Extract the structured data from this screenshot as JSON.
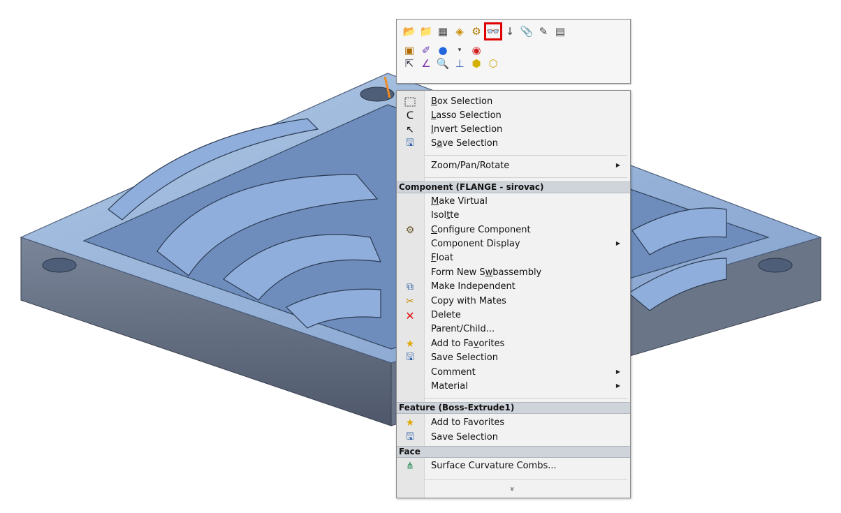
{
  "toolbar": {
    "row1": [
      "open-icon",
      "open-folder-icon",
      "properties-icon",
      "box-component-icon",
      "assembly-icon",
      "hide-show-icon",
      "sort-icon",
      "paperclip-icon",
      "configure-icon",
      "document-properties-icon"
    ],
    "row2": [
      "edit-part-icon",
      "sketch-icon",
      "appearance-icon",
      "color-chevron-icon",
      "mates-icon"
    ],
    "row3": [
      "select-icon",
      "sketch-line-icon",
      "zoom-to-selection-icon",
      "normal-to-icon",
      "face-icon",
      "face-alt-icon"
    ],
    "highlighted": "hide-show-icon"
  },
  "menu": {
    "items_selection": [
      {
        "label": "Box Selection",
        "mnemonic": "B",
        "icon": "box-selection-icon"
      },
      {
        "label": "Lasso Selection",
        "mnemonic": "L",
        "icon": "lasso-icon"
      },
      {
        "label": "Invert Selection",
        "mnemonic": "I",
        "icon": "invert-selection-icon"
      },
      {
        "label": "Save Selection",
        "mnemonic": "a",
        "icon": "save-selection-icon"
      }
    ],
    "zoom_pan_rotate": "Zoom/Pan/Rotate",
    "component_header": "Component (FLANGE - sirovac)",
    "component_items": [
      {
        "label": "Make Virtual",
        "icon": ""
      },
      {
        "label": "Isolate",
        "icon": ""
      },
      {
        "label": "Configure Component",
        "icon": "configure-component-icon"
      },
      {
        "label": "Component Display",
        "icon": "",
        "submenu": true
      },
      {
        "label": "Float",
        "icon": ""
      },
      {
        "label": "Form New Subassembly",
        "icon": ""
      },
      {
        "label": "Make Independent",
        "icon": "make-independent-icon"
      },
      {
        "label": "Copy with Mates",
        "icon": "copy-with-mates-icon"
      },
      {
        "label": "Delete",
        "icon": "delete-icon"
      },
      {
        "label": "Parent/Child...",
        "icon": ""
      },
      {
        "label": "Add to Favorites",
        "icon": "favorites-icon"
      },
      {
        "label": "Save Selection",
        "icon": "save-selection-icon"
      },
      {
        "label": "Comment",
        "icon": "",
        "submenu": true
      },
      {
        "label": "Material",
        "icon": "",
        "submenu": true
      }
    ],
    "feature_header": "Feature (Boss-Extrude1)",
    "feature_items": [
      {
        "label": "Add to Favorites",
        "icon": "favorites-icon"
      },
      {
        "label": "Save Selection",
        "icon": "save-selection-icon"
      }
    ],
    "face_header": "Face",
    "face_items": [
      {
        "label": "Surface Curvature Combs...",
        "icon": "curvature-combs-icon"
      }
    ],
    "more_chevron": "»"
  },
  "colors": {
    "part_top": "#8fb0d8",
    "part_side": "#5f6b80",
    "menu_bg": "#f2f2f2",
    "header_bg": "#cfd3da",
    "highlight": "#e00000"
  }
}
